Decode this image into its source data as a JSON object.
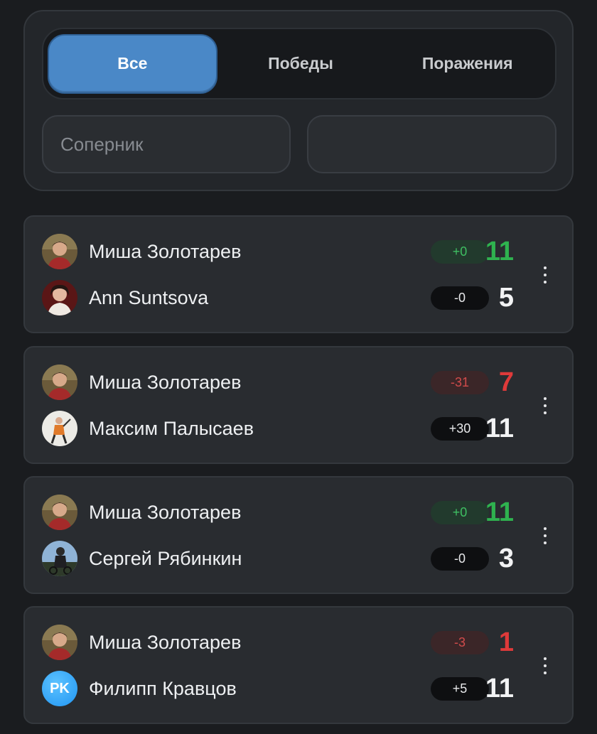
{
  "tabs": [
    {
      "label": "Все",
      "active": true
    },
    {
      "label": "Победы",
      "active": false
    },
    {
      "label": "Поражения",
      "active": false
    }
  ],
  "filters": {
    "opponent_placeholder": "Соперник",
    "second_field_value": ""
  },
  "matches": [
    {
      "p1": {
        "name": "Миша Золотарев",
        "delta": "+0",
        "score": "11",
        "result": "win",
        "avatar": "photo-avatar"
      },
      "p2": {
        "name": "Ann Suntsova",
        "delta": "-0",
        "score": "5",
        "avatar": "photo-avatar"
      }
    },
    {
      "p1": {
        "name": "Миша Золотарев",
        "delta": "-31",
        "score": "7",
        "result": "loss",
        "avatar": "photo-avatar"
      },
      "p2": {
        "name": "Максим Палысаев",
        "delta": "+30",
        "score": "11",
        "avatar": "photo-avatar"
      }
    },
    {
      "p1": {
        "name": "Миша Золотарев",
        "delta": "+0",
        "score": "11",
        "result": "win",
        "avatar": "photo-avatar"
      },
      "p2": {
        "name": "Сергей Рябинкин",
        "delta": "-0",
        "score": "3",
        "avatar": "photo-avatar"
      }
    },
    {
      "p1": {
        "name": "Миша Золотарев",
        "delta": "-3",
        "score": "1",
        "result": "loss",
        "avatar": "photo-avatar"
      },
      "p2": {
        "name": "Филипп Кравцов",
        "delta": "+5",
        "score": "11",
        "avatar": "initials",
        "initials": "PK"
      }
    }
  ],
  "colors": {
    "accent": "#4a88c7",
    "win": "#2fb24f",
    "loss": "#de3a3a"
  }
}
